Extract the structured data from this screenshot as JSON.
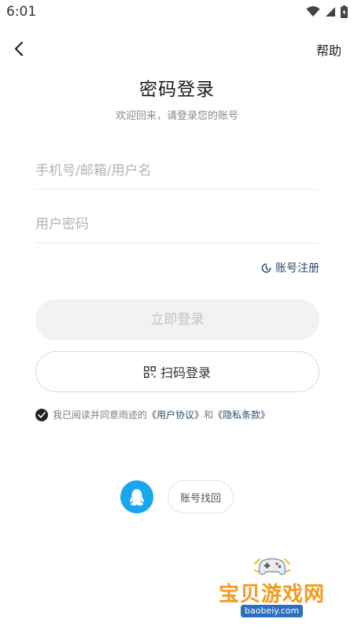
{
  "status_bar": {
    "time": "6:01"
  },
  "header": {
    "help_label": "帮助"
  },
  "main": {
    "title": "密码登录",
    "subtitle": "欢迎回来，请登录您的账号",
    "account_placeholder": "手机号/邮箱/用户名",
    "password_placeholder": "用户密码",
    "register_label": "账号注册",
    "login_label": "立即登录",
    "scan_login_label": "扫码登录"
  },
  "agreement": {
    "prefix": "我已阅读并同意雨迹的",
    "user_agreement": "《用户协议》",
    "and": "和",
    "privacy_policy": "《隐私条款》"
  },
  "footer": {
    "recover_label": "账号找回"
  },
  "watermark": {
    "name": "宝贝游戏网",
    "url": "baobeiy.com"
  },
  "colors": {
    "accent_link": "#2a4a6e",
    "qq_blue": "#1aa6ed",
    "watermark_orange": "#f29a1d"
  },
  "icons": [
    "wifi-icon",
    "signal-icon",
    "battery-icon",
    "back-arrow-icon",
    "refresh-user-icon",
    "qr-code-icon",
    "check-icon",
    "qq-penguin-icon",
    "gamepad-icon"
  ]
}
